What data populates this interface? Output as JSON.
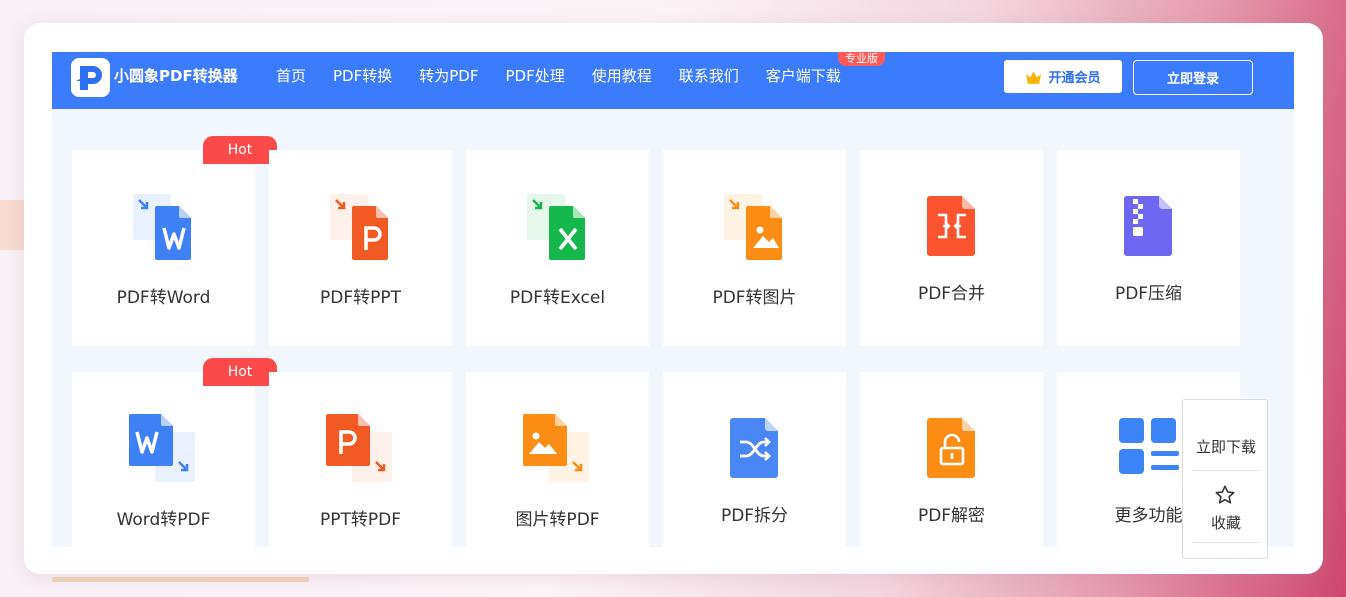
{
  "header": {
    "brand": "小圆象PDF转换器",
    "nav": [
      "首页",
      "PDF转换",
      "转为PDF",
      "PDF处理",
      "使用教程",
      "联系我们",
      "客户端下载"
    ],
    "pro_badge": "专业版",
    "vip_button": "开通会员",
    "login_button": "立即登录"
  },
  "tools": [
    {
      "label": "PDF转Word",
      "badge": "Hot",
      "icon": "pdf-to-word-icon",
      "color": "#4080f5"
    },
    {
      "label": "PDF转PPT",
      "badge": "",
      "icon": "pdf-to-ppt-icon",
      "color": "#f25a24"
    },
    {
      "label": "PDF转Excel",
      "badge": "",
      "icon": "pdf-to-excel-icon",
      "color": "#16b84b"
    },
    {
      "label": "PDF转图片",
      "badge": "",
      "icon": "pdf-to-image-icon",
      "color": "#fb8c14"
    },
    {
      "label": "PDF合并",
      "badge": "",
      "icon": "pdf-merge-icon",
      "color": "#fb542e"
    },
    {
      "label": "PDF压缩",
      "badge": "",
      "icon": "pdf-compress-icon",
      "color": "#6f67f2"
    },
    {
      "label": "Word转PDF",
      "badge": "Hot",
      "icon": "word-to-pdf-icon",
      "color": "#4080f5"
    },
    {
      "label": "PPT转PDF",
      "badge": "",
      "icon": "ppt-to-pdf-icon",
      "color": "#f25a24"
    },
    {
      "label": "图片转PDF",
      "badge": "",
      "icon": "image-to-pdf-icon",
      "color": "#fb8c14"
    },
    {
      "label": "PDF拆分",
      "badge": "",
      "icon": "pdf-split-icon",
      "color": "#4a86f4"
    },
    {
      "label": "PDF解密",
      "badge": "",
      "icon": "pdf-decrypt-icon",
      "color": "#fb8c14"
    },
    {
      "label": "更多功能",
      "badge": "",
      "icon": "more-features-icon",
      "color": "#3d84f7"
    }
  ],
  "float_panel": {
    "download": "立即下载",
    "favorite": "收藏"
  },
  "colors": {
    "nav_bar": "#3c7bfb",
    "hot_badge": "#fc4a4a",
    "pro_badge": "#fe5a57"
  }
}
